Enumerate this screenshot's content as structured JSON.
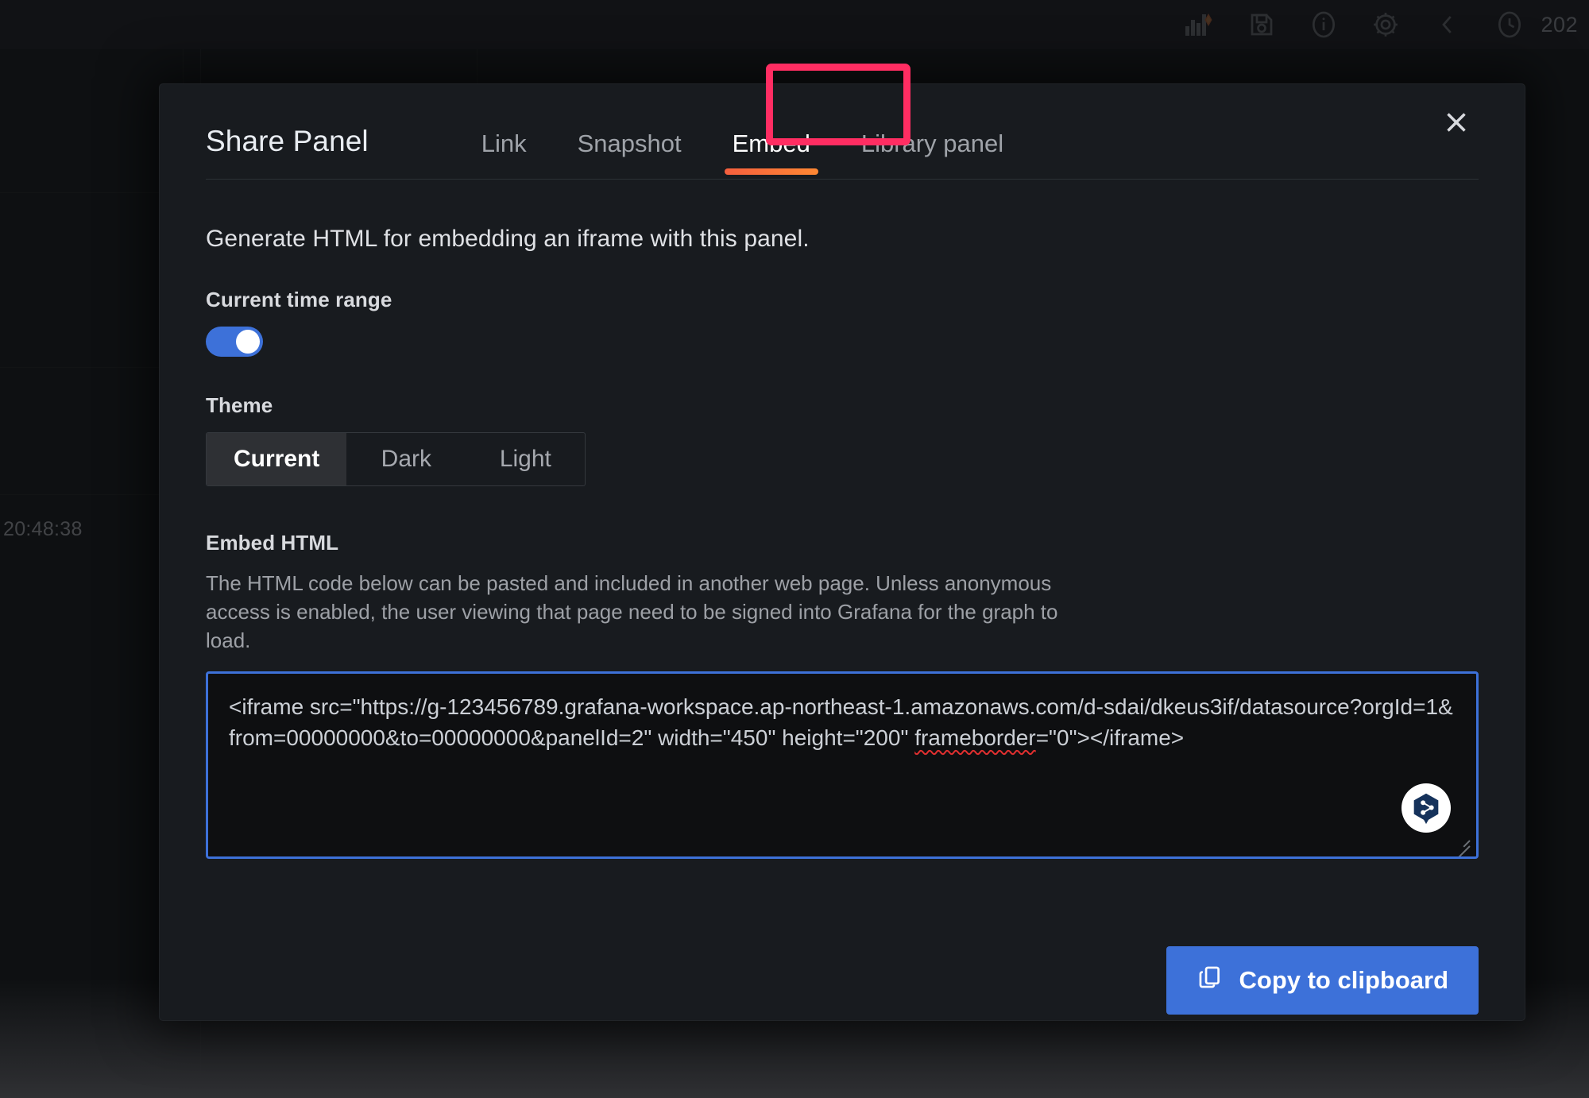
{
  "toolbar": {
    "icons": [
      {
        "name": "panel-chart-sparkle-icon",
        "glyph": "chart-sparkle"
      },
      {
        "name": "save-dashboard-icon",
        "glyph": "save"
      },
      {
        "name": "panel-info-icon",
        "glyph": "info"
      },
      {
        "name": "dashboard-settings-icon",
        "glyph": "gear"
      },
      {
        "name": "collapse-chevron-left-icon",
        "glyph": "chevron-left"
      },
      {
        "name": "time-picker-clock-icon",
        "glyph": "clock"
      }
    ],
    "time_label": "202"
  },
  "background_panel": {
    "axis_time_label": "20:48:38"
  },
  "modal": {
    "title": "Share Panel",
    "close_label": "×",
    "tabs": [
      {
        "label": "Link",
        "active": false
      },
      {
        "label": "Snapshot",
        "active": false
      },
      {
        "label": "Embed",
        "active": true
      },
      {
        "label": "Library panel",
        "active": false
      }
    ],
    "lead_text": "Generate HTML for embedding an iframe with this panel.",
    "time_range": {
      "label": "Current time range",
      "enabled": true
    },
    "theme": {
      "label": "Theme",
      "options": [
        "Current",
        "Dark",
        "Light"
      ],
      "selected": "Current"
    },
    "embed": {
      "label": "Embed HTML",
      "help_text": "The HTML code below can be pasted and included in another web page. Unless anonymous access is enabled, the user viewing that page need to be signed into Grafana for the graph to load.",
      "code_part_1": "<iframe src=\"https://g-123456789.grafana-workspace.ap-northeast-1.amazonaws.com/d-sdai/dkeus3if/datasource?orgId=1&from=00000000&to=00000000&panelId=2\" width=\"450\" height=\"200\" ",
      "code_spellcheck_word": "frameborder",
      "code_part_2": "=\"0\"></iframe>"
    },
    "copy_button": "Copy to clipboard"
  },
  "colors": {
    "accent_blue": "#3d71d9",
    "highlight_pink": "#ff2d62",
    "active_tab_orange": "#f55f3e",
    "modal_bg": "#181b1f",
    "code_bg": "#0e0f11"
  }
}
